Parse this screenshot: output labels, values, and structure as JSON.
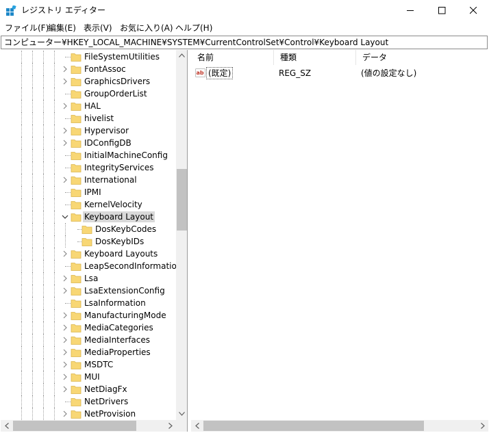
{
  "window": {
    "title": "レジストリ エディター",
    "icon": "registry-editor-icon"
  },
  "menu": {
    "items": [
      "ファイル(F)",
      "編集(E)",
      "表示(V)",
      "お気に入り(A)",
      "ヘルプ(H)"
    ]
  },
  "address": {
    "path": "コンピューター¥HKEY_LOCAL_MACHINE¥SYSTEM¥CurrentControlSet¥Control¥Keyboard Layout"
  },
  "tree": {
    "nodes": [
      {
        "label": "FileSystemUtilities",
        "level": 1,
        "expander": "none"
      },
      {
        "label": "FontAssoc",
        "level": 1,
        "expander": "collapsed"
      },
      {
        "label": "GraphicsDrivers",
        "level": 1,
        "expander": "collapsed"
      },
      {
        "label": "GroupOrderList",
        "level": 1,
        "expander": "none"
      },
      {
        "label": "HAL",
        "level": 1,
        "expander": "collapsed"
      },
      {
        "label": "hivelist",
        "level": 1,
        "expander": "none"
      },
      {
        "label": "Hypervisor",
        "level": 1,
        "expander": "collapsed"
      },
      {
        "label": "IDConfigDB",
        "level": 1,
        "expander": "collapsed"
      },
      {
        "label": "InitialMachineConfig",
        "level": 1,
        "expander": "none"
      },
      {
        "label": "IntegrityServices",
        "level": 1,
        "expander": "none"
      },
      {
        "label": "International",
        "level": 1,
        "expander": "collapsed"
      },
      {
        "label": "IPMI",
        "level": 1,
        "expander": "none"
      },
      {
        "label": "KernelVelocity",
        "level": 1,
        "expander": "none"
      },
      {
        "label": "Keyboard Layout",
        "level": 1,
        "expander": "expanded",
        "selected": true
      },
      {
        "label": "DosKeybCodes",
        "level": 2,
        "expander": "none"
      },
      {
        "label": "DosKeybIDs",
        "level": 2,
        "expander": "none"
      },
      {
        "label": "Keyboard Layouts",
        "level": 1,
        "expander": "collapsed"
      },
      {
        "label": "LeapSecondInformation",
        "level": 1,
        "expander": "none"
      },
      {
        "label": "Lsa",
        "level": 1,
        "expander": "collapsed"
      },
      {
        "label": "LsaExtensionConfig",
        "level": 1,
        "expander": "collapsed"
      },
      {
        "label": "LsaInformation",
        "level": 1,
        "expander": "none"
      },
      {
        "label": "ManufacturingMode",
        "level": 1,
        "expander": "collapsed"
      },
      {
        "label": "MediaCategories",
        "level": 1,
        "expander": "collapsed"
      },
      {
        "label": "MediaInterfaces",
        "level": 1,
        "expander": "collapsed"
      },
      {
        "label": "MediaProperties",
        "level": 1,
        "expander": "collapsed"
      },
      {
        "label": "MSDTC",
        "level": 1,
        "expander": "collapsed"
      },
      {
        "label": "MUI",
        "level": 1,
        "expander": "collapsed"
      },
      {
        "label": "NetDiagFx",
        "level": 1,
        "expander": "collapsed"
      },
      {
        "label": "NetDrivers",
        "level": 1,
        "expander": "none"
      },
      {
        "label": "NetProvision",
        "level": 1,
        "expander": "collapsed"
      }
    ]
  },
  "list": {
    "columns": [
      "名前",
      "種類",
      "データ"
    ],
    "rows": [
      {
        "name": "(既定)",
        "type": "REG_SZ",
        "data": "(値の設定なし)",
        "icon": "string-value-icon"
      }
    ]
  },
  "colors": {
    "folder": "#f8d775",
    "selection": "#d9d9d9",
    "scrollbar_track": "#f0f0f0",
    "scrollbar_thumb": "#c2c2c2"
  }
}
